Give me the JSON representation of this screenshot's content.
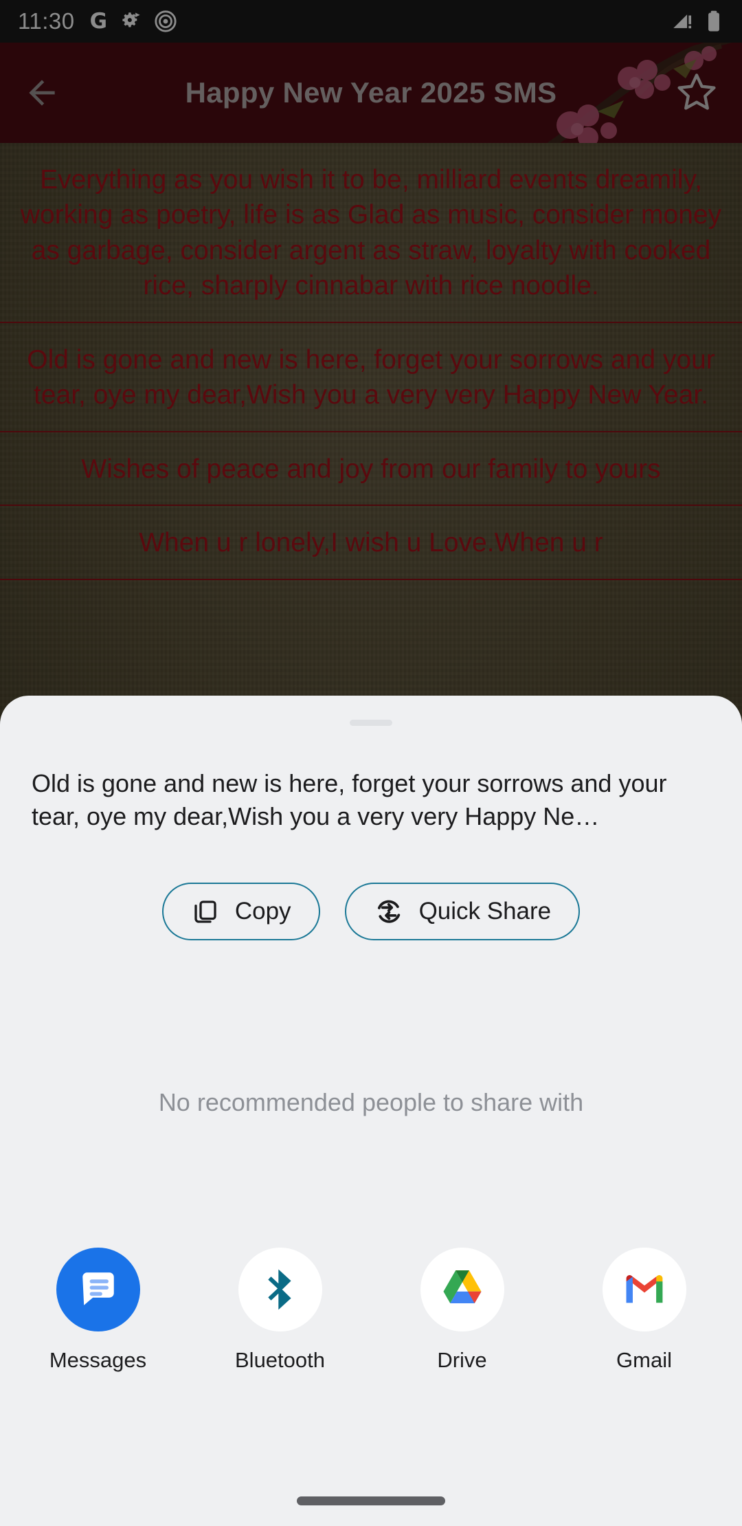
{
  "status_bar": {
    "time": "11:30",
    "icons_left": [
      "google-g-icon",
      "settings-arrow-icon",
      "record-target-icon"
    ],
    "icons_right": [
      "signal-warning-icon",
      "battery-full-icon"
    ]
  },
  "app_bar": {
    "back_icon": "back-arrow-icon",
    "title": "Happy New Year 2025 SMS",
    "favorite_icon": "star-outline-icon",
    "background_color": "#4e0c13",
    "title_color": "#b6aeae"
  },
  "sms_list": {
    "items": [
      {
        "text": "Everything as you wish it to be, milliard events dreamily, working as poetry, life is as Glad as music, consider money as garbage, consider argent as straw, loyalty with cooked rice, sharply cinnabar with rice noodle."
      },
      {
        "text": "Old is gone and new is here, forget your sorrows and your tear, oye my dear,Wish you a very very Happy New Year."
      },
      {
        "text": "Wishes of peace and joy from our family to yours"
      },
      {
        "text": "When u r lonely,I wish u Love.When u r"
      }
    ],
    "text_color": "#a5121b",
    "divider_color": "#8c1016"
  },
  "share_sheet": {
    "handle": "drag-handle",
    "preview_text": "Old is gone and new is here, forget your sorrows and your tear, oye my dear,Wish you a very very Happy Ne…",
    "actions": [
      {
        "label": "Copy",
        "icon": "copy-icon"
      },
      {
        "label": "Quick Share",
        "icon": "quick-share-icon"
      }
    ],
    "empty_state": "No recommended people to share with",
    "accent_color": "#1a7896",
    "background_color": "#eff0f2",
    "apps": [
      {
        "label": "Messages",
        "icon": "messages-app-icon"
      },
      {
        "label": "Bluetooth",
        "icon": "bluetooth-app-icon"
      },
      {
        "label": "Drive",
        "icon": "drive-app-icon"
      },
      {
        "label": "Gmail",
        "icon": "gmail-app-icon"
      }
    ]
  },
  "nav_bar": {
    "gesture_pill": "home-gesture-pill"
  }
}
